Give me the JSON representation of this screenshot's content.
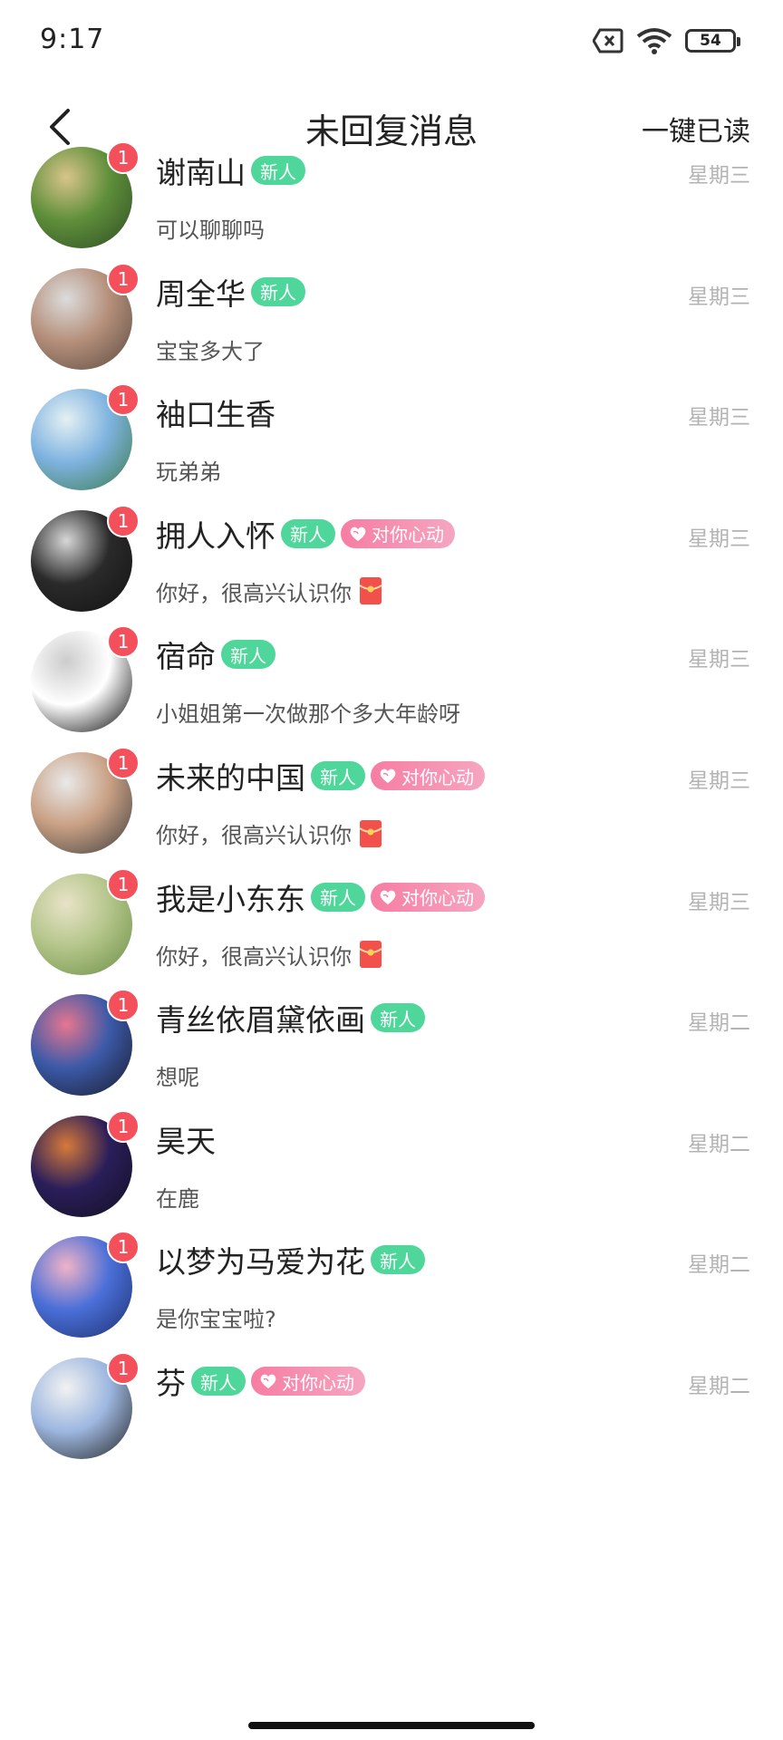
{
  "status_bar": {
    "time": "9:17",
    "battery": "54"
  },
  "nav": {
    "title": "未回复消息",
    "read_all": "一键已读"
  },
  "tags": {
    "new": "新人",
    "heart": "对你心动"
  },
  "conversations": [
    {
      "name": "谢南山",
      "new": true,
      "heart": false,
      "message": "可以聊聊吗",
      "redpacket": false,
      "time": "星期三",
      "unread": "1",
      "avatar_colors": [
        "#5f8f3a",
        "#d8c48a",
        "#2d4c25"
      ]
    },
    {
      "name": "周全华",
      "new": true,
      "heart": false,
      "message": "宝宝多大了",
      "redpacket": false,
      "time": "星期三",
      "unread": "1",
      "avatar_colors": [
        "#b58f7a",
        "#dcdcdc",
        "#5a4a40"
      ]
    },
    {
      "name": "袖口生香",
      "new": false,
      "heart": false,
      "message": "玩弟弟",
      "redpacket": false,
      "time": "星期三",
      "unread": "1",
      "avatar_colors": [
        "#7fb3e0",
        "#e4f0f3",
        "#3a7a4a"
      ]
    },
    {
      "name": "拥人入怀",
      "new": true,
      "heart": true,
      "message": "你好，很高兴认识你",
      "redpacket": true,
      "time": "星期三",
      "unread": "1",
      "avatar_colors": [
        "#2a2a2a",
        "#d7d7d7",
        "#121212"
      ]
    },
    {
      "name": "宿命",
      "new": true,
      "heart": false,
      "message": "小姐姐第一次做那个多大年龄呀",
      "redpacket": false,
      "time": "星期三",
      "unread": "1",
      "avatar_colors": [
        "#ffffff",
        "#cccccc",
        "#000000"
      ]
    },
    {
      "name": "未来的中国",
      "new": true,
      "heart": true,
      "message": "你好，很高兴认识你",
      "redpacket": true,
      "time": "星期三",
      "unread": "1",
      "avatar_colors": [
        "#c9a084",
        "#e9e9e9",
        "#3c3c3c"
      ]
    },
    {
      "name": "我是小东东",
      "new": true,
      "heart": true,
      "message": "你好，很高兴认识你",
      "redpacket": true,
      "time": "星期三",
      "unread": "1",
      "avatar_colors": [
        "#b4c58a",
        "#e8e3c8",
        "#6b8e45"
      ]
    },
    {
      "name": "青丝依眉黛依画",
      "new": true,
      "heart": false,
      "message": "想呢",
      "redpacket": false,
      "time": "星期二",
      "unread": "1",
      "avatar_colors": [
        "#3b5aa8",
        "#e6768f",
        "#1a1a2a"
      ]
    },
    {
      "name": "昊天",
      "new": false,
      "heart": false,
      "message": "在鹿",
      "redpacket": false,
      "time": "星期二",
      "unread": "1",
      "avatar_colors": [
        "#2a1e5a",
        "#d67a3a",
        "#121020"
      ]
    },
    {
      "name": "以梦为马爱为花",
      "new": true,
      "heart": false,
      "message": "是你宝宝啦?",
      "redpacket": false,
      "time": "星期二",
      "unread": "1",
      "avatar_colors": [
        "#4a6fd8",
        "#f0b3c7",
        "#1e2f6e"
      ]
    },
    {
      "name": "芬",
      "new": true,
      "heart": true,
      "message": "",
      "redpacket": false,
      "time": "星期二",
      "unread": "1",
      "avatar_colors": [
        "#9db7e0",
        "#f2f2f2",
        "#222222"
      ]
    }
  ]
}
